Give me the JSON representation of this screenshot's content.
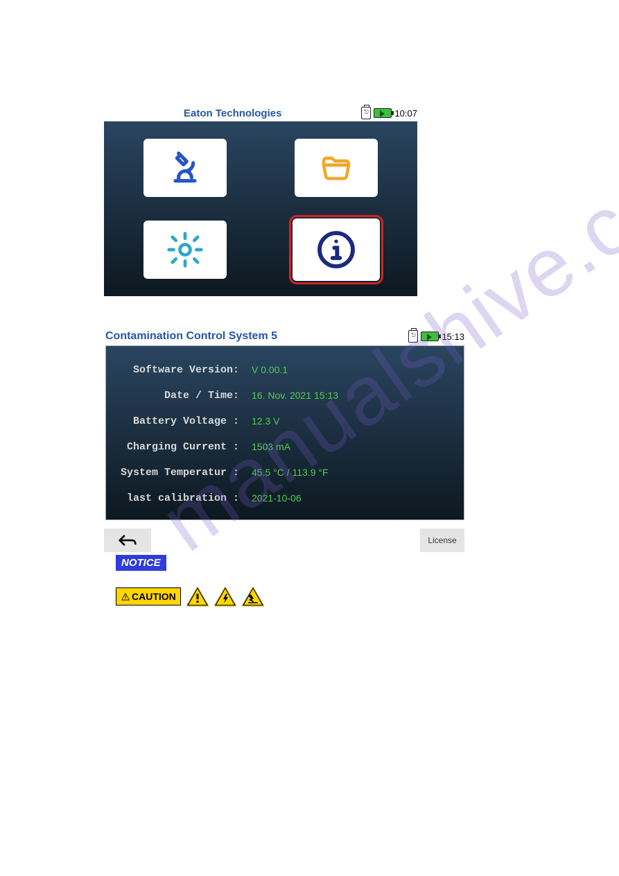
{
  "watermark": "manualshive.com",
  "screen1": {
    "title": "Eaton Technologies",
    "time": "10:07",
    "tiles": {
      "microscope": "microscope",
      "folder": "folder",
      "settings": "settings",
      "info": "info"
    }
  },
  "screen2": {
    "title": "Contamination Control System 5",
    "time": "15:13",
    "rows": {
      "software_version": {
        "label": "Software Version:",
        "value": "V 0.00.1"
      },
      "datetime": {
        "label": "Date / Time:",
        "value": "16. Nov. 2021  15:13"
      },
      "battery_voltage": {
        "label": "Battery Voltage :",
        "value": "12.3 V"
      },
      "charging_current": {
        "label": "Charging Current :",
        "value": "1503 mA"
      },
      "system_temp": {
        "label": "System Temperatur :",
        "value": "45.5 °C / 113.9 °F"
      },
      "last_calibration": {
        "label": "last calibration :",
        "value": "2021-10-06"
      }
    },
    "license_label": "License"
  },
  "badges": {
    "notice": "NOTICE",
    "caution": "CAUTION"
  }
}
